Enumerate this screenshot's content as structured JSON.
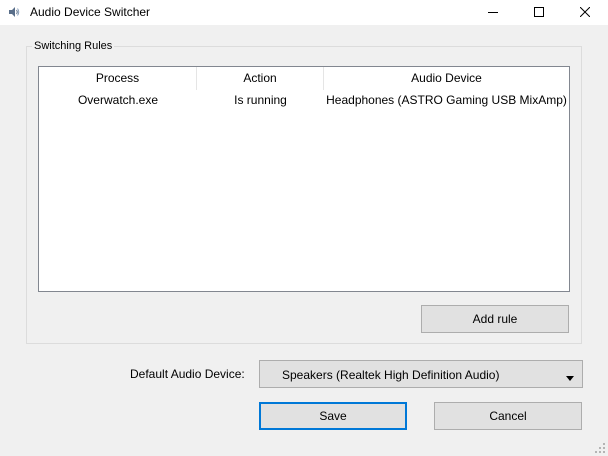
{
  "window": {
    "title": "Audio Device Switcher"
  },
  "title_icons": {
    "app": "speaker-icon",
    "minimize": "minimize-icon",
    "maximize": "maximize-icon",
    "close": "close-icon"
  },
  "rules_group": {
    "title": "Switching Rules",
    "columns": [
      "Process",
      "Action",
      "Audio Device"
    ],
    "rows": [
      {
        "process": "Overwatch.exe",
        "action": "Is running",
        "device": "Headphones (ASTRO Gaming USB MixAmp)"
      }
    ],
    "add_rule_label": "Add rule"
  },
  "default_device": {
    "label": "Default Audio Device:",
    "selected": "Speakers (Realtek High Definition Audio)"
  },
  "footer": {
    "save_label": "Save",
    "cancel_label": "Cancel"
  },
  "colors": {
    "window_bg": "#f0f0f0",
    "titlebar_bg": "#ffffff",
    "button_bg": "#e1e1e1",
    "button_border": "#adadad",
    "focus_accent": "#0078d7",
    "list_border": "#828790"
  }
}
